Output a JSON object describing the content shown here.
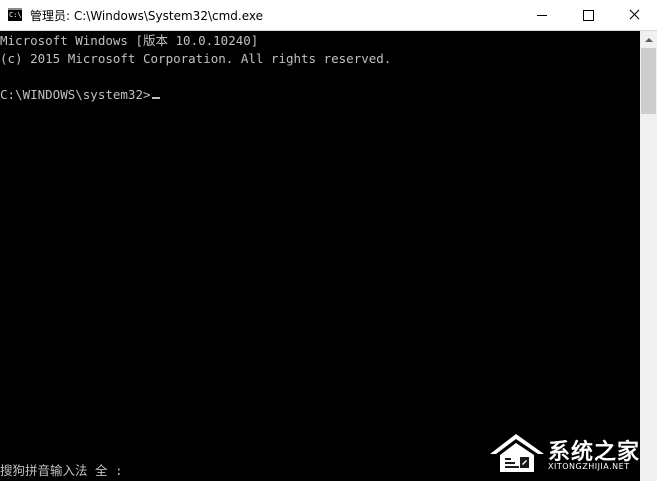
{
  "window": {
    "title": "管理员: C:\\Windows\\System32\\cmd.exe",
    "icon": "cmd-icon",
    "controls": {
      "minimize": "minimize-icon",
      "maximize": "maximize-icon",
      "close": "close-icon"
    }
  },
  "console": {
    "lines": [
      "Microsoft Windows [版本 10.0.10240]",
      "(c) 2015 Microsoft Corporation. All rights reserved.",
      "",
      "C:\\WINDOWS\\system32>"
    ],
    "ime_status": "搜狗拼音输入法 全 :"
  },
  "watermark": {
    "text": "系统之家",
    "sub": "XITONGZHIJIA.NET",
    "icon": "house-logo-icon"
  },
  "colors": {
    "console_bg": "#000000",
    "console_fg": "#c0c0c0",
    "titlebar_bg": "#ffffff",
    "scrollbar_bg": "#f0f0f0"
  }
}
